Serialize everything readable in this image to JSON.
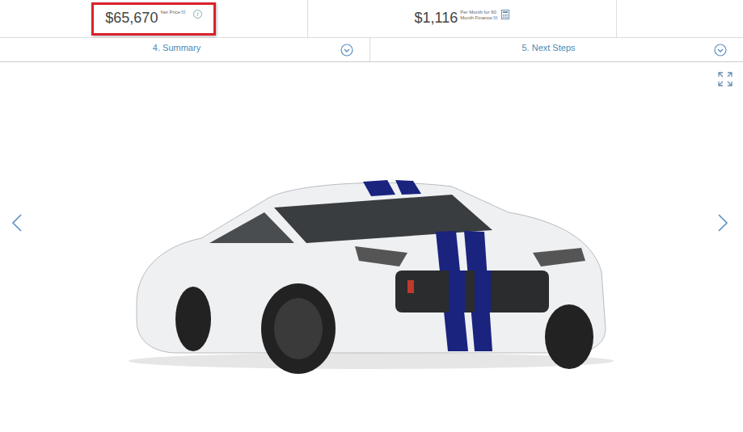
{
  "pricing": [
    {
      "amount": "$65,670",
      "lines": [
        "Net Price"
      ],
      "footnote": "55",
      "kind": "info",
      "icon": "i",
      "highlighted": true
    },
    {
      "amount": "$1,116",
      "lines": [
        "Per Month for 60",
        "Month Finance"
      ],
      "footnote": "56",
      "kind": "calculator",
      "icon": "",
      "highlighted": false
    }
  ],
  "steps": [
    {
      "label": "4. Summary",
      "expanded": false
    },
    {
      "label": "5. Next Steps",
      "expanded": false
    }
  ]
}
